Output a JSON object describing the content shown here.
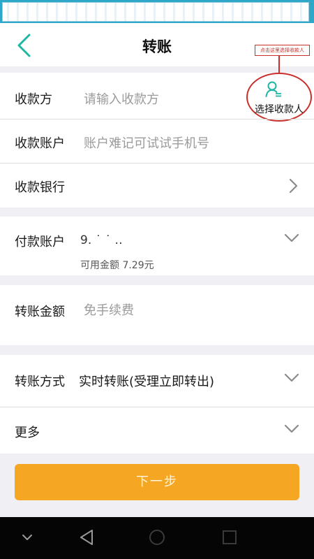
{
  "header": {
    "title": "转账",
    "callout_text": "点击这里选择收款人"
  },
  "form": {
    "payee": {
      "label": "收款方",
      "placeholder": "请输入收款方",
      "picker_label": "选择收款人",
      "picker_icon": "contacts-icon"
    },
    "payee_account": {
      "label": "收款账户",
      "placeholder": "账户难记可试试手机号"
    },
    "payee_bank": {
      "label": "收款银行"
    },
    "payer_account": {
      "label": "付款账户",
      "value": "9. ˙ ˙ ‥",
      "balance": "可用金额 7.29元"
    },
    "amount": {
      "label": "转账金额",
      "placeholder": "免手续费"
    },
    "transfer_mode": {
      "label": "转账方式",
      "value": "实时转账(受理立即转出)"
    },
    "more": {
      "label": "更多"
    }
  },
  "actions": {
    "next_label": "下一步"
  },
  "colors": {
    "accent": "#1fb6a6",
    "button": "#f5a623",
    "annotation": "#c9302c",
    "background": "#efeff4"
  },
  "system_nav": [
    "chevron-down-icon",
    "back-triangle-icon",
    "home-icon",
    "recents-icon"
  ]
}
